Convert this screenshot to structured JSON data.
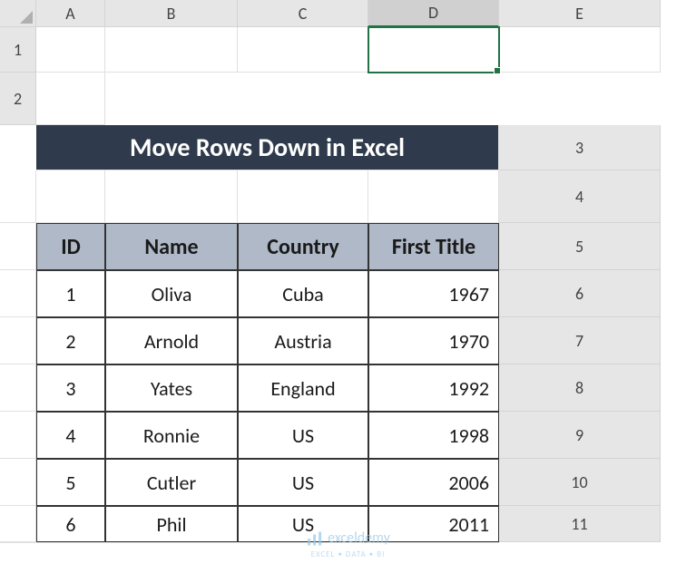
{
  "columns": [
    "A",
    "B",
    "C",
    "D",
    "E"
  ],
  "rows": [
    "1",
    "2",
    "3",
    "4",
    "5",
    "6",
    "7",
    "8",
    "9",
    "10",
    "11"
  ],
  "selected_column": "D",
  "title": "Move Rows Down in Excel",
  "table": {
    "headers": [
      "ID",
      "Name",
      "Country",
      "First Title"
    ],
    "data": [
      {
        "id": "1",
        "name": "Oliva",
        "country": "Cuba",
        "first_title": "1967"
      },
      {
        "id": "2",
        "name": "Arnold",
        "country": "Austria",
        "first_title": "1970"
      },
      {
        "id": "3",
        "name": "Yates",
        "country": "England",
        "first_title": "1992"
      },
      {
        "id": "4",
        "name": "Ronnie",
        "country": "US",
        "first_title": "1998"
      },
      {
        "id": "5",
        "name": "Cutler",
        "country": "US",
        "first_title": "2006"
      },
      {
        "id": "6",
        "name": "Phil",
        "country": "US",
        "first_title": "2011"
      }
    ]
  },
  "watermark": {
    "name": "exceldemy",
    "tagline": "EXCEL • DATA • BI"
  }
}
